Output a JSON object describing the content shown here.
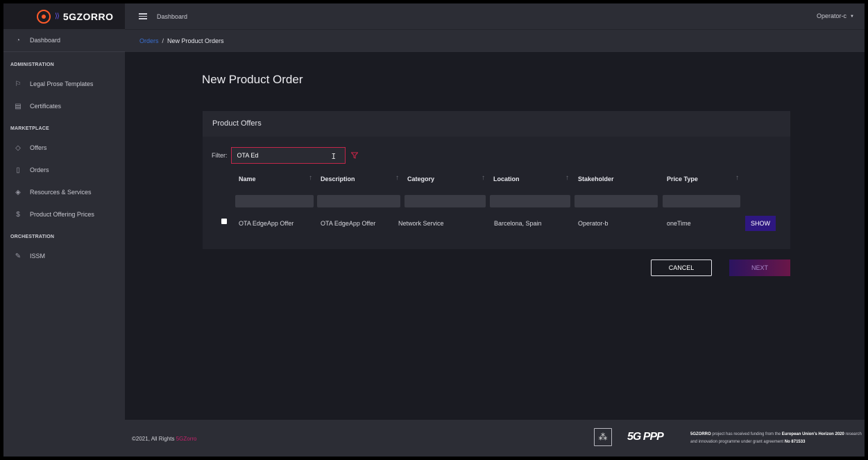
{
  "brand": {
    "name": "5GZORRO"
  },
  "header": {
    "title": "Dashboard",
    "user": "Operator-c"
  },
  "sidebar": {
    "dashboard": "Dashboard",
    "sections": [
      {
        "title": "ADMINISTRATION",
        "items": [
          {
            "label": "Legal Prose Templates",
            "icon": "flag-icon"
          },
          {
            "label": "Certificates",
            "icon": "certificate-icon"
          }
        ]
      },
      {
        "title": "MARKETPLACE",
        "items": [
          {
            "label": "Offers",
            "icon": "tag-icon"
          },
          {
            "label": "Orders",
            "icon": "bookmark-icon"
          },
          {
            "label": "Resources & Services",
            "icon": "layers-icon"
          },
          {
            "label": "Product Offering Prices",
            "icon": "dollar-icon"
          }
        ]
      },
      {
        "title": "ORCHESTRATION",
        "items": [
          {
            "label": "ISSM",
            "icon": "pen-icon"
          }
        ]
      }
    ]
  },
  "breadcrumb": {
    "parent": "Orders",
    "separator": "/",
    "current": "New Product Orders"
  },
  "page": {
    "title": "New Product Order"
  },
  "card": {
    "title": "Product Offers"
  },
  "filter": {
    "label": "Filter:",
    "value": "OTA Ed"
  },
  "table": {
    "columns": [
      "Name",
      "Description",
      "Category",
      "Location",
      "Stakeholder",
      "Price Type"
    ],
    "rows": [
      {
        "name": "OTA EdgeApp Offer",
        "description": "OTA EdgeApp Offer",
        "category": "Network Service",
        "location": "Barcelona, Spain",
        "stakeholder": "Operator-b",
        "price_type": "oneTime",
        "action": "SHOW"
      }
    ]
  },
  "actions": {
    "cancel": "CANCEL",
    "next": "NEXT"
  },
  "footer": {
    "copyright_prefix": "©2021, All Rights ",
    "copyright_brand": "5GZorro",
    "ppp_logo": "5G PPP",
    "funding_bold1": "5GZORRO",
    "funding_text1": " project has received funding from the ",
    "funding_bold2": "European Union's Horizon 2020",
    "funding_text2": " research and innovation programme under grant agreement ",
    "funding_bold3": "No 871533"
  },
  "colors": {
    "accent": "#c2264a",
    "show_button": "#2e1780",
    "link": "#3a6fd0",
    "brand_orange": "#ff5a2a"
  }
}
